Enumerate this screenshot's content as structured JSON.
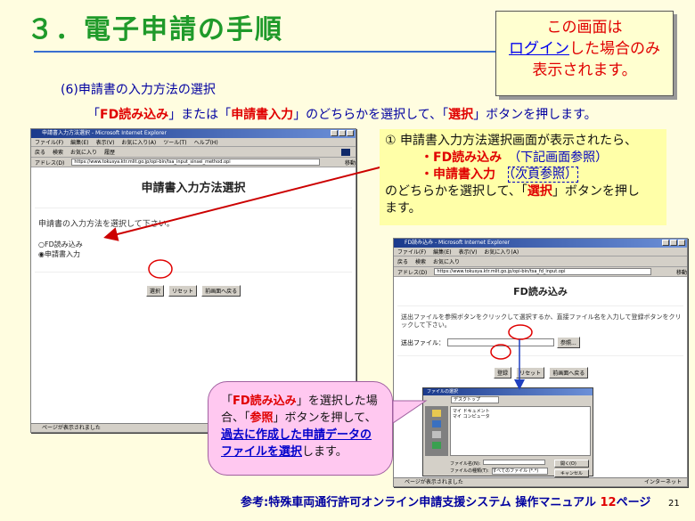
{
  "slide": {
    "title": "３．電子申請の手順",
    "note_line1": "この画面は",
    "note_link": "ログイン",
    "note_line2_rest": "した場合のみ",
    "note_line3": "表示されます。",
    "subhead": "(6)申請書の入力方法の選択",
    "instr_pre": "「",
    "instr_fd": "FD読み込み",
    "instr_mid": "」または「",
    "instr_form": "申請書入力",
    "instr_mid2": "」のどちらかを選択して、「",
    "instr_sel": "選択",
    "instr_post": "」ボタンを押します。",
    "callout1": {
      "line1": "① 申請書入力方法選択画面が表示されたら、",
      "opt1": "・FD読み込み",
      "opt1_note": "（下記画面参照）",
      "opt2": "・申請書入力",
      "opt2_note": "（次頁参照）",
      "line4_pre": "のどちらかを選択して、「",
      "line4_sel": "選択",
      "line4_post": "」ボタンを押し",
      "line5": "ます。"
    },
    "callout2": {
      "p1": "「",
      "fd": "FD読み込み",
      "p2": "」を選択した場合、「",
      "ref": "参照",
      "p3": "」ボタンを押して、",
      "link": "過去に作成した申請データのファイルを選択",
      "p4": "します。"
    },
    "reference_pre": "参考:特殊車両通行許可オンライン申請支援システム 操作マニュアル ",
    "reference_num": "12",
    "reference_post": "ページ",
    "page_number": "21"
  },
  "browser1": {
    "title": "申請書入力方法選択 - Microsoft Internet Explorer",
    "menus": [
      "ファイル(F)",
      "編集(E)",
      "表示(V)",
      "お気に入り(A)",
      "ツール(T)",
      "ヘルプ(H)"
    ],
    "toolbar": [
      "戻る",
      "検索",
      "お気に入り",
      "履歴"
    ],
    "address_label": "アドレス(D)",
    "address": "https://www.tokusya.ktr.mlit.go.jp/opi-bin/tsa_input_sinsei_method.opi",
    "go": "移動",
    "page_title": "申請書入力方法選択",
    "prompt": "申請書の入力方法を選択して下さい。",
    "options": [
      "FD読み込み",
      "申請書入力"
    ],
    "buttons": [
      "選択",
      "リセット",
      "前画面へ戻る"
    ],
    "status": "ページが表示されました"
  },
  "browser2": {
    "title": "FD読み込み - Microsoft Internet Explorer",
    "address": "https://www.tokusya.ktr.mlit.go.jp/opi-bin/tsa_fd_input.opi",
    "page_title": "FD読み込み",
    "prompt": "送出ファイルを参照ボタンをクリックして選択するか、直接ファイル名を入力して登録ボタンをクリックして下さい。",
    "file_label": "送出ファイル：",
    "browse": "参照...",
    "buttons": [
      "登録",
      "リセット",
      "前画面へ戻る"
    ],
    "status": "ページが表示されました",
    "zone": "インターネット"
  },
  "dialog": {
    "title": "ファイルの選択",
    "look_in": "デスクトップ",
    "items": [
      "マイ ドキュメント",
      "マイ コンピュータ"
    ],
    "file_name_label": "ファイル名(N):",
    "file_type_label": "ファイルの種類(T):",
    "file_type": "すべてのファイル (*.*)",
    "open": "開く(O)",
    "cancel": "キャンセル"
  },
  "colors": {
    "title": "#1f9a2a",
    "accent_red": "#e00000",
    "navy_text": "#0000a0",
    "callout1_bg": "#ffffa8",
    "callout2_bg": "#ffc8f0"
  }
}
